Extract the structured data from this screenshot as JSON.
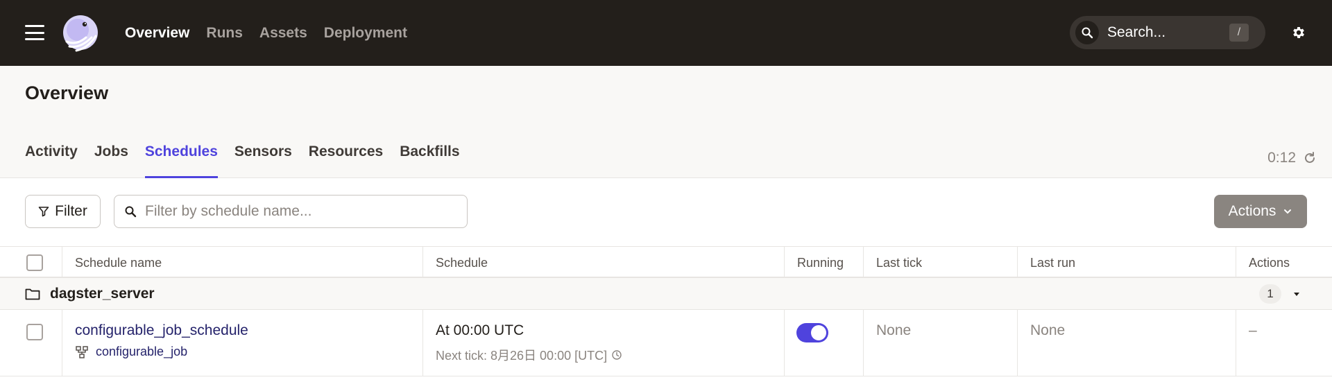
{
  "nav": {
    "items": [
      "Overview",
      "Runs",
      "Assets",
      "Deployment"
    ],
    "search_placeholder": "Search...",
    "search_shortcut": "/"
  },
  "header": {
    "title": "Overview",
    "tabs": [
      "Activity",
      "Jobs",
      "Schedules",
      "Sensors",
      "Resources",
      "Backfills"
    ],
    "active_tab": "Schedules",
    "refresh_countdown": "0:12"
  },
  "toolbar": {
    "filter_label": "Filter",
    "search_placeholder": "Filter by schedule name...",
    "actions_label": "Actions"
  },
  "table": {
    "columns": [
      "Schedule name",
      "Schedule",
      "Running",
      "Last tick",
      "Last run",
      "Actions"
    ],
    "group": {
      "name": "dagster_server",
      "count": "1"
    },
    "rows": [
      {
        "name": "configurable_job_schedule",
        "job": "configurable_job",
        "schedule": "At 00:00 UTC",
        "next_tick": "Next tick: 8月26日 00:00 [UTC]",
        "running": true,
        "last_tick": "None",
        "last_run": "None",
        "actions": "–"
      }
    ]
  },
  "colors": {
    "topbar": "#231f1b",
    "accent": "#4f43dd",
    "link": "#25236b"
  }
}
